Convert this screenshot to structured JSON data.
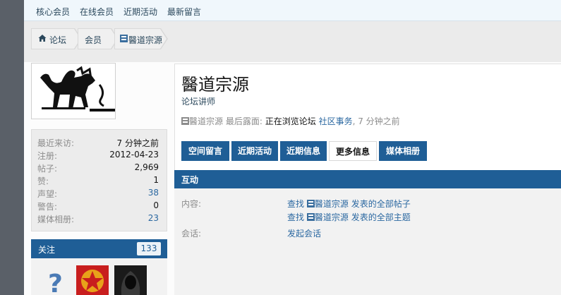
{
  "topnav": {
    "items": [
      "核心会员",
      "在线会员",
      "近期活动",
      "最新留言"
    ]
  },
  "breadcrumb": {
    "home": "论坛",
    "members": "会员",
    "current": "醫道宗源"
  },
  "stats": [
    {
      "label": "最近来访:",
      "value": "7 分钟之前",
      "link": false
    },
    {
      "label": "注册:",
      "value": "2012-04-23",
      "link": false
    },
    {
      "label": "帖子:",
      "value": "2,969",
      "link": false
    },
    {
      "label": "赞:",
      "value": "1",
      "link": false
    },
    {
      "label": "声望:",
      "value": "38",
      "link": true
    },
    {
      "label": "警告:",
      "value": "0",
      "link": false
    },
    {
      "label": "媒体相册:",
      "value": "23",
      "link": true
    }
  ],
  "following": {
    "label": "关注",
    "count": "133"
  },
  "profile": {
    "name": "醫道宗源",
    "title": "论坛讲师",
    "lastseen_name": "醫道宗源",
    "lastseen_label": "最后露面:",
    "lastseen_action": "正在浏览论坛",
    "lastseen_place": "社区事务",
    "lastseen_time": ", 7 分钟之前"
  },
  "tabs": [
    "空间留言",
    "近期活动",
    "近期信息",
    "更多信息",
    "媒体相册"
  ],
  "interaction": {
    "heading": "互动",
    "content_label": "内容:",
    "find_prefix": "查找",
    "posts_user": "醫道宗源",
    "posts_suffix": "发表的全部帖子",
    "threads_user": "醫道宗源",
    "threads_suffix": "发表的全部主题",
    "conversation_label": "会话:",
    "start_conversation": "发起会话"
  },
  "colors": {
    "accent": "#1f5e96",
    "link": "#2b68a1"
  }
}
